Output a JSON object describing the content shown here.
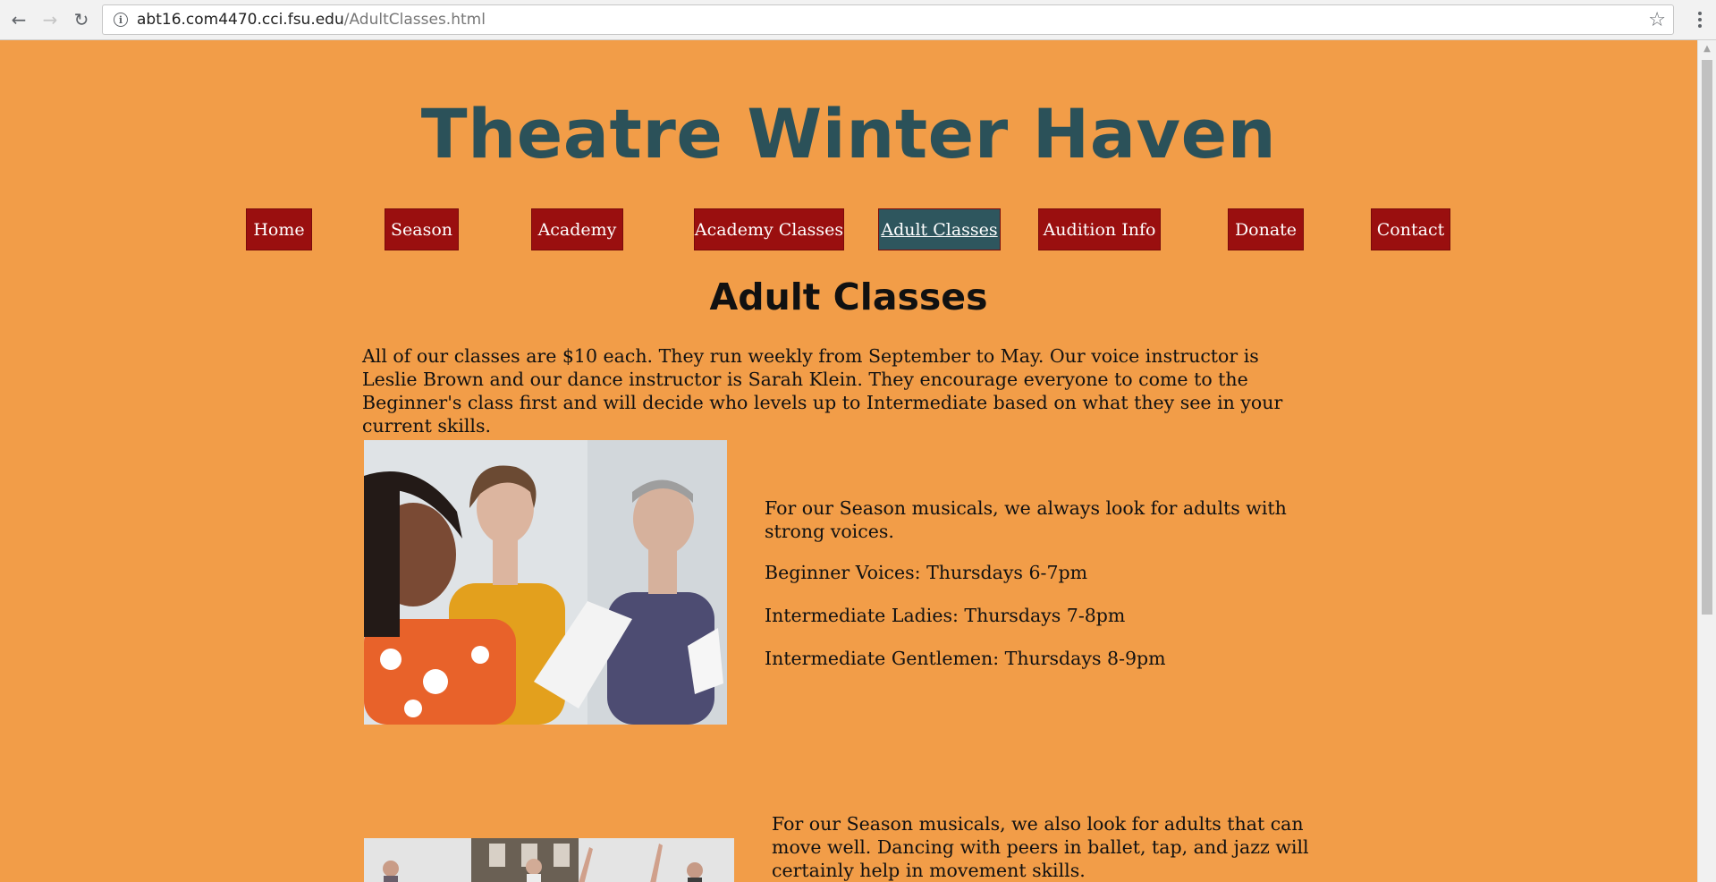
{
  "browser": {
    "url_host": "abt16.com4470.cci.fsu.edu",
    "url_path": "/AdultClasses.html"
  },
  "site": {
    "title": "Theatre Winter Haven",
    "background_color": "#f29d48",
    "title_color": "#2b5159"
  },
  "nav": {
    "button_color": "#9a0f0f",
    "active_color": "#2e565e",
    "items": [
      {
        "label": "Home"
      },
      {
        "label": "Season"
      },
      {
        "label": "Academy"
      },
      {
        "label": "Academy Classes"
      },
      {
        "label": "Adult Classes",
        "active": true
      },
      {
        "label": "Audition Info"
      },
      {
        "label": "Donate"
      },
      {
        "label": "Contact"
      }
    ]
  },
  "main": {
    "heading": "Adult Classes",
    "intro": "All of our classes are $10 each. They run weekly from September to May. Our voice instructor is Leslie Brown and our dance instructor is Sarah Klein. They encourage everyone to come to the Beginner's class first and will decide who levels up to Intermediate based on what they see in your current skills.",
    "voice_section": {
      "description": "For our Season musicals, we always look for adults with strong voices.",
      "classes": [
        "Beginner Voices: Thursdays 6-7pm",
        "Intermediate Ladies: Thursdays 7-8pm",
        "Intermediate Gentlemen: Thursdays 8-9pm"
      ]
    },
    "dance_section": {
      "description": "For our Season musicals, we also look for adults that can move well. Dancing with peers in ballet, tap, and jazz will certainly help in movement skills."
    }
  }
}
